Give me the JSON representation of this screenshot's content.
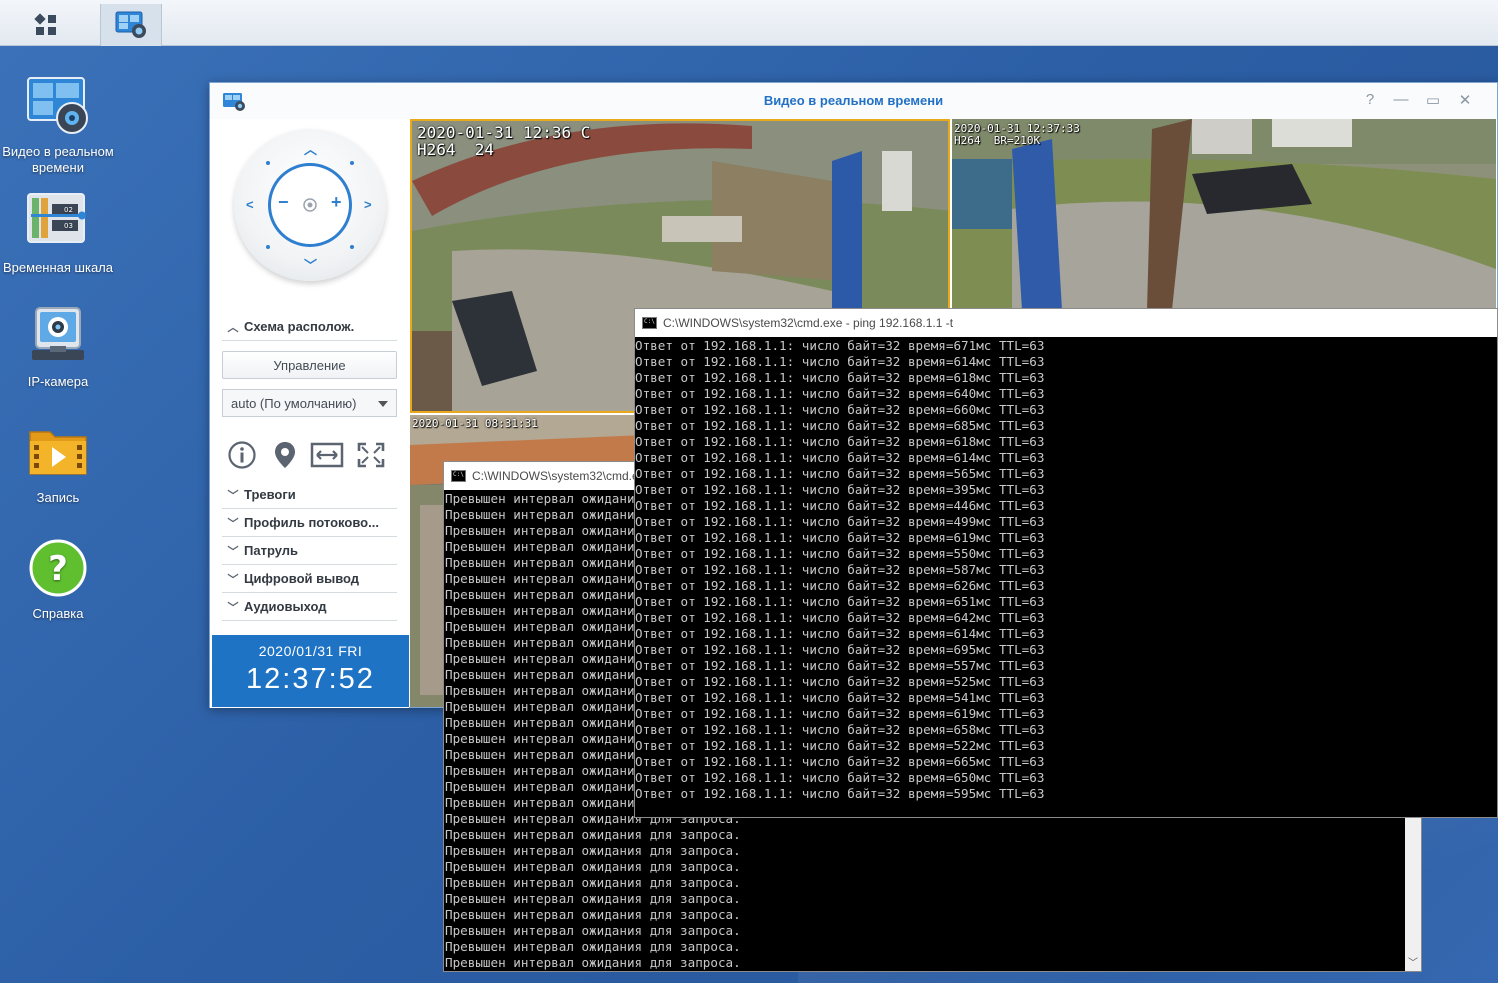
{
  "taskbar": {
    "main_menu_icon": "grid-icon",
    "app_icon": "surveillance-live-icon"
  },
  "desktop": {
    "icons": [
      {
        "label": "Видео в реальном времени",
        "icon": "live-view-icon"
      },
      {
        "label": "Временная шкала",
        "icon": "timeline-icon"
      },
      {
        "label": "IP-камера",
        "icon": "ip-camera-icon"
      },
      {
        "label": "Запись",
        "icon": "recording-icon"
      },
      {
        "label": "Справка",
        "icon": "help-icon"
      }
    ]
  },
  "live_window": {
    "title": "Видео в реальном времени",
    "controls": {
      "help": "?",
      "minimize": "—",
      "maximize": "▭",
      "close": "✕"
    },
    "layout_section": "Схема располож.",
    "manage_button": "Управление",
    "stream_select": "auto (По умолчанию)",
    "sections": [
      "Тревоги",
      "Профиль потоково...",
      "Патруль",
      "Цифровой вывод",
      "Аудиовыход"
    ],
    "clock": {
      "date": "2020/01/31 FRI",
      "time": "12:37:52"
    },
    "cameras": [
      {
        "osd": "2020-01-31 12:36 C\nH264  24"
      },
      {
        "osd": "2020-01-31 12:37:33\nH264  BR=210K"
      },
      {
        "osd": "2020-01-31 08:31:31"
      }
    ],
    "accent_color": "#1e73c5",
    "selected_color": "#e9a91b"
  },
  "cmd_timeout": {
    "title": "C:\\WINDOWS\\system32\\cmd.exe - ping",
    "line": "Превышен интервал ожидания для запроса.",
    "lines_count_visible": 30
  },
  "cmd_ping": {
    "title": "C:\\WINDOWS\\system32\\cmd.exe - ping  192.168.1.1 -t",
    "reply_prefix": "Ответ от 192.168.1.1: число байт=32 время=",
    "reply_suffix": "мс TTL=63",
    "times_ms": [
      671,
      614,
      618,
      640,
      660,
      685,
      618,
      614,
      565,
      395,
      446,
      499,
      619,
      550,
      587,
      626,
      651,
      642,
      614,
      695,
      557,
      525,
      541,
      619,
      658,
      522,
      665,
      650,
      595
    ]
  }
}
